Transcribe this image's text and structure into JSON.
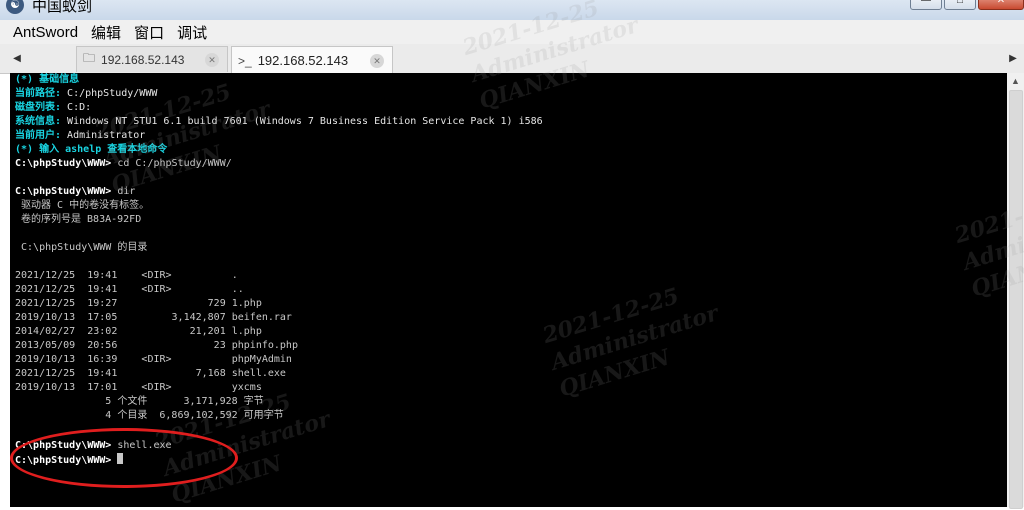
{
  "window": {
    "title": "中国蚁剑",
    "icon": "antsword-logo-icon",
    "controls": [
      "minimize-icon",
      "maximize-icon",
      "close-icon"
    ]
  },
  "menubar": {
    "items": [
      "AntSword",
      "编辑",
      "窗口",
      "调试"
    ]
  },
  "tabs": [
    {
      "label": "192.168.52.143",
      "icon": "folder-icon",
      "active": false
    },
    {
      "label": "192.168.52.143",
      "icon": "terminal-icon",
      "active": true
    }
  ],
  "terminal": {
    "info_header": "(*) 基础信息",
    "path_label": "当前路径:",
    "path_value": " C:/phpStudy/WWW",
    "disk_label": "磁盘列表:",
    "disk_value": " C:D:",
    "sys_label": "系统信息:",
    "sys_value": " Windows NT STU1 6.1 build 7601 (Windows 7 Business Edition Service Pack 1) i586",
    "user_label": "当前用户:",
    "user_value": " Administrator",
    "help_hint": "(*) 输入 ashelp 查看本地命令",
    "prompt": "C:\\phpStudy\\WWW>",
    "cmd1": " cd C:/phpStudy/WWW/",
    "cmd2": " dir",
    "dir_line1": " 驱动器 C 中的卷没有标签。",
    "dir_line2": " 卷的序列号是 B83A-92FD",
    "dir_line3": " C:\\phpStudy\\WWW 的目录",
    "entries": [
      "2021/12/25  19:41    <DIR>          .",
      "2021/12/25  19:41    <DIR>          ..",
      "2021/12/25  19:27               729 1.php",
      "2019/10/13  17:05         3,142,807 beifen.rar",
      "2014/02/27  23:02            21,201 l.php",
      "2013/05/09  20:56                23 phpinfo.php",
      "2019/10/13  16:39    <DIR>          phpMyAdmin",
      "2021/12/25  19:41             7,168 shell.exe",
      "2019/10/13  17:01    <DIR>          yxcms"
    ],
    "summary1": "               5 个文件      3,171,928 字节",
    "summary2": "               4 个目录  6,869,102,592 可用字节",
    "cmd3": " shell.exe"
  },
  "watermark": {
    "date": "2021-12-25",
    "user": "Administrator",
    "org": "QIANXIN"
  },
  "colors": {
    "terminal_bg": "#000000",
    "highlight": "#19d3e0",
    "annotation": "#e01e1e"
  }
}
